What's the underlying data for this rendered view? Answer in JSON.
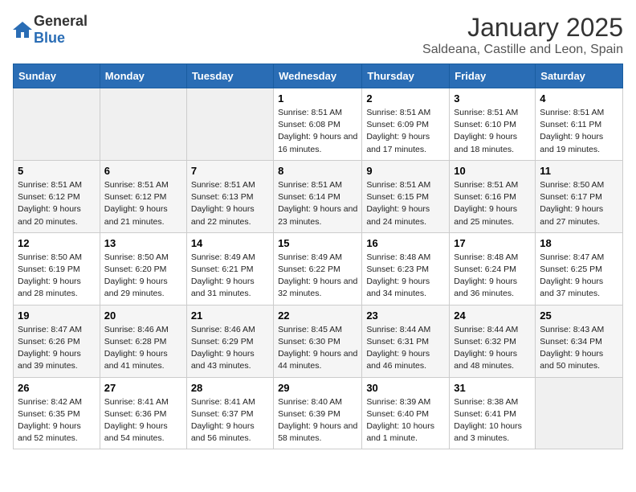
{
  "logo": {
    "general": "General",
    "blue": "Blue"
  },
  "title": "January 2025",
  "subtitle": "Saldeana, Castille and Leon, Spain",
  "weekdays": [
    "Sunday",
    "Monday",
    "Tuesday",
    "Wednesday",
    "Thursday",
    "Friday",
    "Saturday"
  ],
  "weeks": [
    [
      {
        "day": "",
        "info": ""
      },
      {
        "day": "",
        "info": ""
      },
      {
        "day": "",
        "info": ""
      },
      {
        "day": "1",
        "info": "Sunrise: 8:51 AM\nSunset: 6:08 PM\nDaylight: 9 hours and 16 minutes."
      },
      {
        "day": "2",
        "info": "Sunrise: 8:51 AM\nSunset: 6:09 PM\nDaylight: 9 hours and 17 minutes."
      },
      {
        "day": "3",
        "info": "Sunrise: 8:51 AM\nSunset: 6:10 PM\nDaylight: 9 hours and 18 minutes."
      },
      {
        "day": "4",
        "info": "Sunrise: 8:51 AM\nSunset: 6:11 PM\nDaylight: 9 hours and 19 minutes."
      }
    ],
    [
      {
        "day": "5",
        "info": "Sunrise: 8:51 AM\nSunset: 6:12 PM\nDaylight: 9 hours and 20 minutes."
      },
      {
        "day": "6",
        "info": "Sunrise: 8:51 AM\nSunset: 6:12 PM\nDaylight: 9 hours and 21 minutes."
      },
      {
        "day": "7",
        "info": "Sunrise: 8:51 AM\nSunset: 6:13 PM\nDaylight: 9 hours and 22 minutes."
      },
      {
        "day": "8",
        "info": "Sunrise: 8:51 AM\nSunset: 6:14 PM\nDaylight: 9 hours and 23 minutes."
      },
      {
        "day": "9",
        "info": "Sunrise: 8:51 AM\nSunset: 6:15 PM\nDaylight: 9 hours and 24 minutes."
      },
      {
        "day": "10",
        "info": "Sunrise: 8:51 AM\nSunset: 6:16 PM\nDaylight: 9 hours and 25 minutes."
      },
      {
        "day": "11",
        "info": "Sunrise: 8:50 AM\nSunset: 6:17 PM\nDaylight: 9 hours and 27 minutes."
      }
    ],
    [
      {
        "day": "12",
        "info": "Sunrise: 8:50 AM\nSunset: 6:19 PM\nDaylight: 9 hours and 28 minutes."
      },
      {
        "day": "13",
        "info": "Sunrise: 8:50 AM\nSunset: 6:20 PM\nDaylight: 9 hours and 29 minutes."
      },
      {
        "day": "14",
        "info": "Sunrise: 8:49 AM\nSunset: 6:21 PM\nDaylight: 9 hours and 31 minutes."
      },
      {
        "day": "15",
        "info": "Sunrise: 8:49 AM\nSunset: 6:22 PM\nDaylight: 9 hours and 32 minutes."
      },
      {
        "day": "16",
        "info": "Sunrise: 8:48 AM\nSunset: 6:23 PM\nDaylight: 9 hours and 34 minutes."
      },
      {
        "day": "17",
        "info": "Sunrise: 8:48 AM\nSunset: 6:24 PM\nDaylight: 9 hours and 36 minutes."
      },
      {
        "day": "18",
        "info": "Sunrise: 8:47 AM\nSunset: 6:25 PM\nDaylight: 9 hours and 37 minutes."
      }
    ],
    [
      {
        "day": "19",
        "info": "Sunrise: 8:47 AM\nSunset: 6:26 PM\nDaylight: 9 hours and 39 minutes."
      },
      {
        "day": "20",
        "info": "Sunrise: 8:46 AM\nSunset: 6:28 PM\nDaylight: 9 hours and 41 minutes."
      },
      {
        "day": "21",
        "info": "Sunrise: 8:46 AM\nSunset: 6:29 PM\nDaylight: 9 hours and 43 minutes."
      },
      {
        "day": "22",
        "info": "Sunrise: 8:45 AM\nSunset: 6:30 PM\nDaylight: 9 hours and 44 minutes."
      },
      {
        "day": "23",
        "info": "Sunrise: 8:44 AM\nSunset: 6:31 PM\nDaylight: 9 hours and 46 minutes."
      },
      {
        "day": "24",
        "info": "Sunrise: 8:44 AM\nSunset: 6:32 PM\nDaylight: 9 hours and 48 minutes."
      },
      {
        "day": "25",
        "info": "Sunrise: 8:43 AM\nSunset: 6:34 PM\nDaylight: 9 hours and 50 minutes."
      }
    ],
    [
      {
        "day": "26",
        "info": "Sunrise: 8:42 AM\nSunset: 6:35 PM\nDaylight: 9 hours and 52 minutes."
      },
      {
        "day": "27",
        "info": "Sunrise: 8:41 AM\nSunset: 6:36 PM\nDaylight: 9 hours and 54 minutes."
      },
      {
        "day": "28",
        "info": "Sunrise: 8:41 AM\nSunset: 6:37 PM\nDaylight: 9 hours and 56 minutes."
      },
      {
        "day": "29",
        "info": "Sunrise: 8:40 AM\nSunset: 6:39 PM\nDaylight: 9 hours and 58 minutes."
      },
      {
        "day": "30",
        "info": "Sunrise: 8:39 AM\nSunset: 6:40 PM\nDaylight: 10 hours and 1 minute."
      },
      {
        "day": "31",
        "info": "Sunrise: 8:38 AM\nSunset: 6:41 PM\nDaylight: 10 hours and 3 minutes."
      },
      {
        "day": "",
        "info": ""
      }
    ]
  ]
}
